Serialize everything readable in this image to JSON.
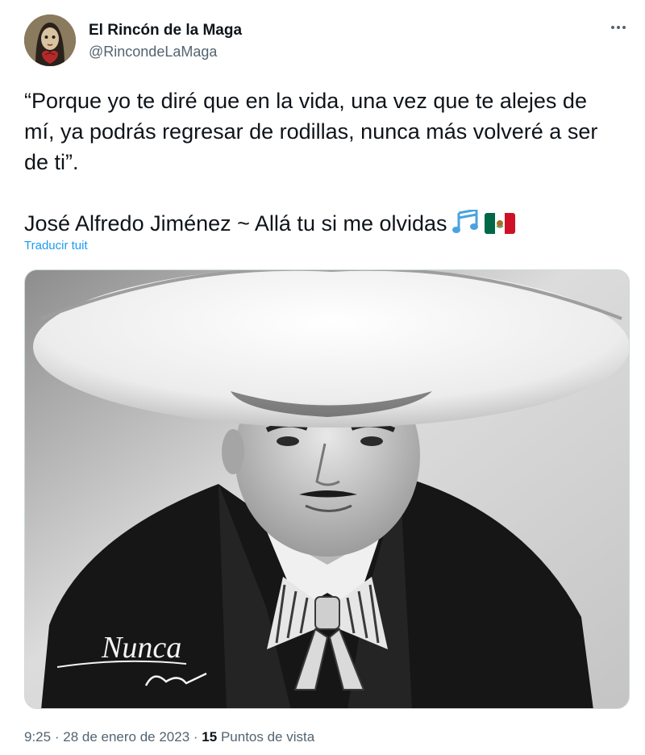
{
  "author": {
    "display_name": "El Rincón de la Maga",
    "handle": "@RincondeLaMaga"
  },
  "tweet": {
    "paragraph_1": "“Porque yo te diré que en la vida, una vez que te alejes de mí, ya podrás regresar de rodillas, nunca más volveré a ser de ti”.",
    "paragraph_2": "José Alfredo Jiménez ~ Allá tu si me olvidas",
    "emojis": [
      "musical-notes-icon",
      "mexico-flag-icon"
    ],
    "translate_label": "Traducir tuit"
  },
  "media": {
    "signature": "Nunca"
  },
  "meta": {
    "time": "9:25",
    "date": "28 de enero de 2023",
    "separator": "·",
    "views_count": "15",
    "views_label": "Puntos de vista"
  },
  "colors": {
    "text": "#0f1419",
    "secondary": "#536471",
    "link": "#1d9bf0",
    "border": "#cfd9de"
  }
}
